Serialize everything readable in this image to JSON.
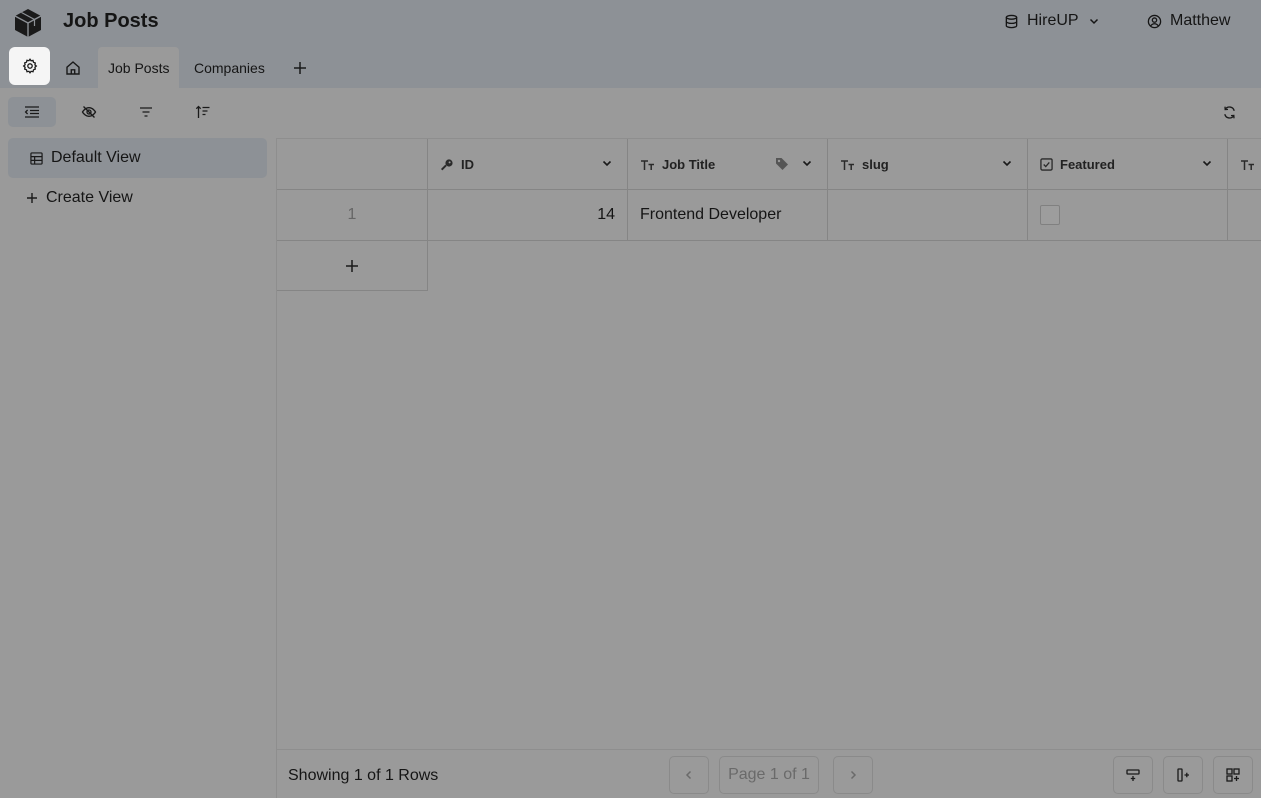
{
  "header": {
    "title": "Job Posts",
    "database": "HireUP",
    "user": "Matthew"
  },
  "tabs": [
    {
      "label": "Job Posts",
      "active": true
    },
    {
      "label": "Companies",
      "active": false
    }
  ],
  "sidebar": {
    "views": [
      {
        "label": "Default View",
        "active": true
      },
      {
        "label": "Create View",
        "active": false
      }
    ]
  },
  "grid": {
    "columns": [
      {
        "name": "ID",
        "type_icon": "key-icon"
      },
      {
        "name": "Job Title",
        "type_icon": "text-type-icon",
        "extra_icon": "tag-icon"
      },
      {
        "name": "slug",
        "type_icon": "text-type-icon"
      },
      {
        "name": "Featured",
        "type_icon": "checkbox-icon"
      },
      {
        "name": "",
        "type_icon": "text-type-icon"
      }
    ],
    "rows": [
      {
        "index": "1",
        "id": "14",
        "job_title": "Frontend Developer",
        "slug": "",
        "featured": false
      }
    ]
  },
  "footer": {
    "row_count": "Showing 1 of 1 Rows",
    "page": "Page 1 of 1"
  }
}
